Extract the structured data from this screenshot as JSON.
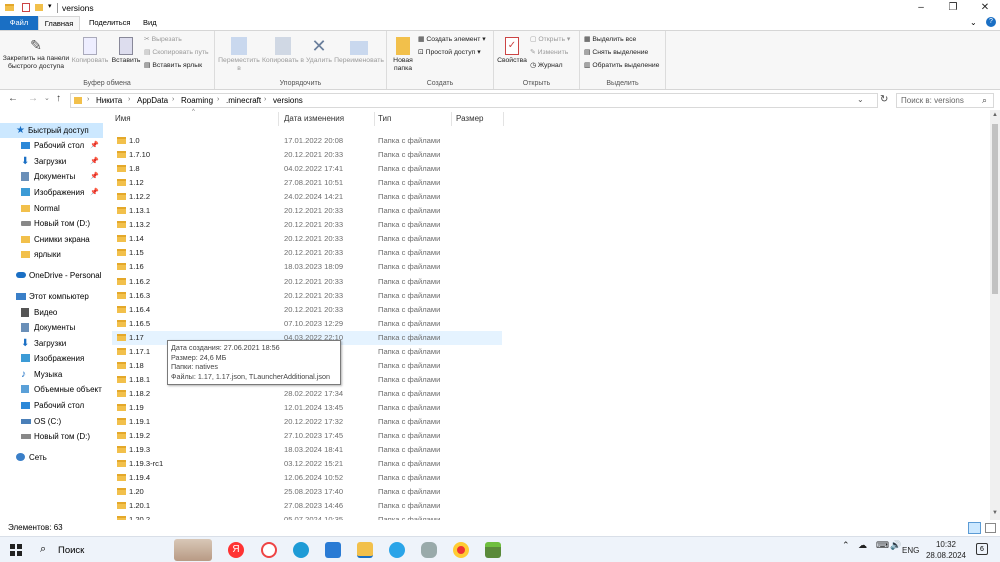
{
  "window": {
    "title": "versions"
  },
  "tabs": [
    "Файл",
    "Главная",
    "Поделиться",
    "Вид"
  ],
  "ribbon": {
    "clipboard": {
      "pin": "Закрепить на панели быстрого доступа",
      "copy": "Копировать",
      "paste": "Вставить",
      "cut": "Вырезать",
      "copy_path": "Скопировать путь",
      "paste_shortcut": "Вставить ярлык",
      "label": "Буфер обмена"
    },
    "organize": {
      "move": "Переместить в",
      "copyto": "Копировать в",
      "delete": "Удалить",
      "rename": "Переименовать",
      "label": "Упорядочить"
    },
    "create": {
      "new_folder": "Новая папка",
      "new_item": "Создать элемент",
      "easy_access": "Простой доступ",
      "label": "Создать"
    },
    "open": {
      "properties": "Свойства",
      "open": "Открыть",
      "edit": "Изменить",
      "history": "Журнал",
      "label": "Открыть"
    },
    "select": {
      "all": "Выделить все",
      "none": "Снять выделение",
      "invert": "Обратить выделение",
      "label": "Выделить"
    }
  },
  "address": {
    "crumbs": [
      "Никита",
      "AppData",
      "Roaming",
      ".minecraft",
      "versions"
    ],
    "search_placeholder": "Поиск в: versions"
  },
  "nav": {
    "quick_access": "Быстрый доступ",
    "pinned": [
      "Рабочий стол",
      "Загрузки",
      "Документы",
      "Изображения"
    ],
    "others": [
      "Normal",
      "Новый том (D:)",
      "Снимки экрана",
      "ярлыки"
    ],
    "onedrive": "OneDrive - Personal",
    "this_pc": "Этот компьютер",
    "pc_items": [
      "Видео",
      "Документы",
      "Загрузки",
      "Изображения",
      "Музыка",
      "Объемные объект",
      "Рабочий стол",
      "OS (C:)",
      "Новый том (D:)"
    ],
    "network": "Сеть"
  },
  "columns": {
    "name": "Имя",
    "date": "Дата изменения",
    "type": "Тип",
    "size": "Размер"
  },
  "files": [
    {
      "name": "1.0",
      "date": "17.01.2022 20:08",
      "type": "Папка с файлами"
    },
    {
      "name": "1.7.10",
      "date": "20.12.2021 20:33",
      "type": "Папка с файлами"
    },
    {
      "name": "1.8",
      "date": "04.02.2022 17:41",
      "type": "Папка с файлами"
    },
    {
      "name": "1.12",
      "date": "27.08.2021 10:51",
      "type": "Папка с файлами"
    },
    {
      "name": "1.12.2",
      "date": "24.02.2024 14:21",
      "type": "Папка с файлами"
    },
    {
      "name": "1.13.1",
      "date": "20.12.2021 20:33",
      "type": "Папка с файлами"
    },
    {
      "name": "1.13.2",
      "date": "20.12.2021 20:33",
      "type": "Папка с файлами"
    },
    {
      "name": "1.14",
      "date": "20.12.2021 20:33",
      "type": "Папка с файлами"
    },
    {
      "name": "1.15",
      "date": "20.12.2021 20:33",
      "type": "Папка с файлами"
    },
    {
      "name": "1.16",
      "date": "18.03.2023 18:09",
      "type": "Папка с файлами"
    },
    {
      "name": "1.16.2",
      "date": "20.12.2021 20:33",
      "type": "Папка с файлами"
    },
    {
      "name": "1.16.3",
      "date": "20.12.2021 20:33",
      "type": "Папка с файлами"
    },
    {
      "name": "1.16.4",
      "date": "20.12.2021 20:33",
      "type": "Папка с файлами"
    },
    {
      "name": "1.16.5",
      "date": "07.10.2023 12:29",
      "type": "Папка с файлами"
    },
    {
      "name": "1.17",
      "date": "04.03.2022 22:10",
      "type": "Папка с файлами"
    },
    {
      "name": "1.17.1",
      "date": "",
      "type": "Папка с файлами"
    },
    {
      "name": "1.18",
      "date": "",
      "type": "Папка с файлами"
    },
    {
      "name": "1.18.1",
      "date": "",
      "type": "Папка с файлами"
    },
    {
      "name": "1.18.2",
      "date": "28.02.2022 17:34",
      "type": "Папка с файлами"
    },
    {
      "name": "1.19",
      "date": "12.01.2024 13:45",
      "type": "Папка с файлами"
    },
    {
      "name": "1.19.1",
      "date": "20.12.2022 17:32",
      "type": "Папка с файлами"
    },
    {
      "name": "1.19.2",
      "date": "27.10.2023 17:45",
      "type": "Папка с файлами"
    },
    {
      "name": "1.19.3",
      "date": "18.03.2024 18:41",
      "type": "Папка с файлами"
    },
    {
      "name": "1.19.3-rc1",
      "date": "03.12.2022 15:21",
      "type": "Папка с файлами"
    },
    {
      "name": "1.19.4",
      "date": "12.06.2024 10:52",
      "type": "Папка с файлами"
    },
    {
      "name": "1.20",
      "date": "25.08.2023 17:40",
      "type": "Папка с файлами"
    },
    {
      "name": "1.20.1",
      "date": "27.08.2023 14:46",
      "type": "Папка с файлами"
    },
    {
      "name": "1.20.2",
      "date": "05.07.2024 10:35",
      "type": "Папка с файлами"
    }
  ],
  "tooltip": {
    "created": "Дата создания: 27.06.2021 18:56",
    "size": "Размер: 24,6 МБ",
    "folders": "Папки: natives",
    "files": "Файлы: 1.17, 1.17.json, TLauncherAdditional.json"
  },
  "status": {
    "count": "Элементов: 63"
  },
  "taskbar": {
    "search": "Поиск",
    "lang": "ENG",
    "time": "10:32",
    "date": "28.08.2024",
    "notif": "6"
  },
  "colors": {
    "accent": "#1a6fc4",
    "selection": "#cce8ff",
    "hover": "#e5f3ff",
    "folder": "#f2c04b"
  }
}
